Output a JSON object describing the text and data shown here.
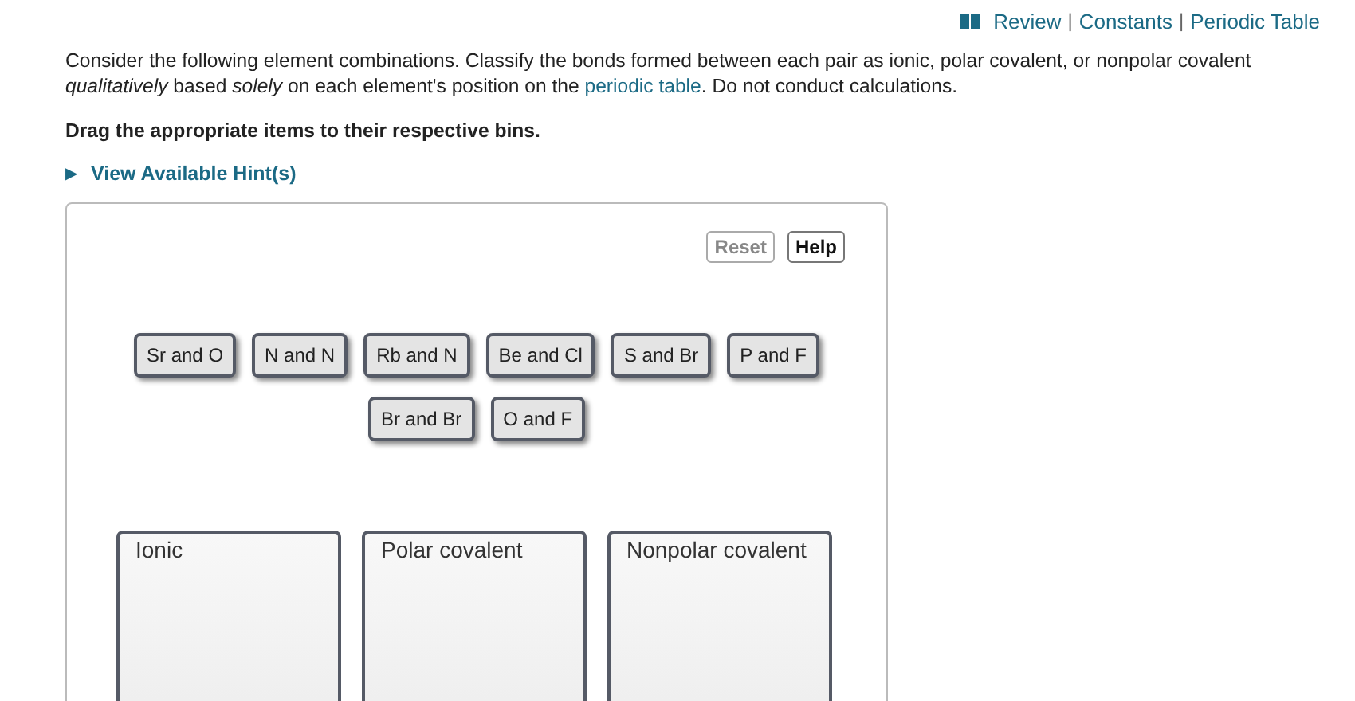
{
  "top_links": {
    "items": [
      "Review",
      "Constants",
      "Periodic Table"
    ],
    "separator": "|"
  },
  "question": {
    "before": "Consider the following element combinations. Classify the bonds formed between each pair as ionic, polar covalent, or nonpolar covalent *qualitatively* based *solely* on each element's position on the ",
    "link": "periodic table",
    "after": ". Do not conduct calculations."
  },
  "instruction": "Drag the appropriate items to their respective bins.",
  "hint": {
    "arrow": "▶",
    "label": "View Available Hint(s)"
  },
  "buttons": [
    {
      "label": "Reset",
      "disabled": true
    },
    {
      "label": "Help",
      "disabled": false
    }
  ],
  "item_rows": [
    [
      "Sr and O",
      "N and N",
      "Rb and N",
      "Be and Cl",
      "S and Br",
      "P and F"
    ],
    [
      "Br and Br",
      "O and F"
    ]
  ],
  "bins": [
    "Ionic",
    "Polar covalent",
    "Nonpolar covalent"
  ]
}
